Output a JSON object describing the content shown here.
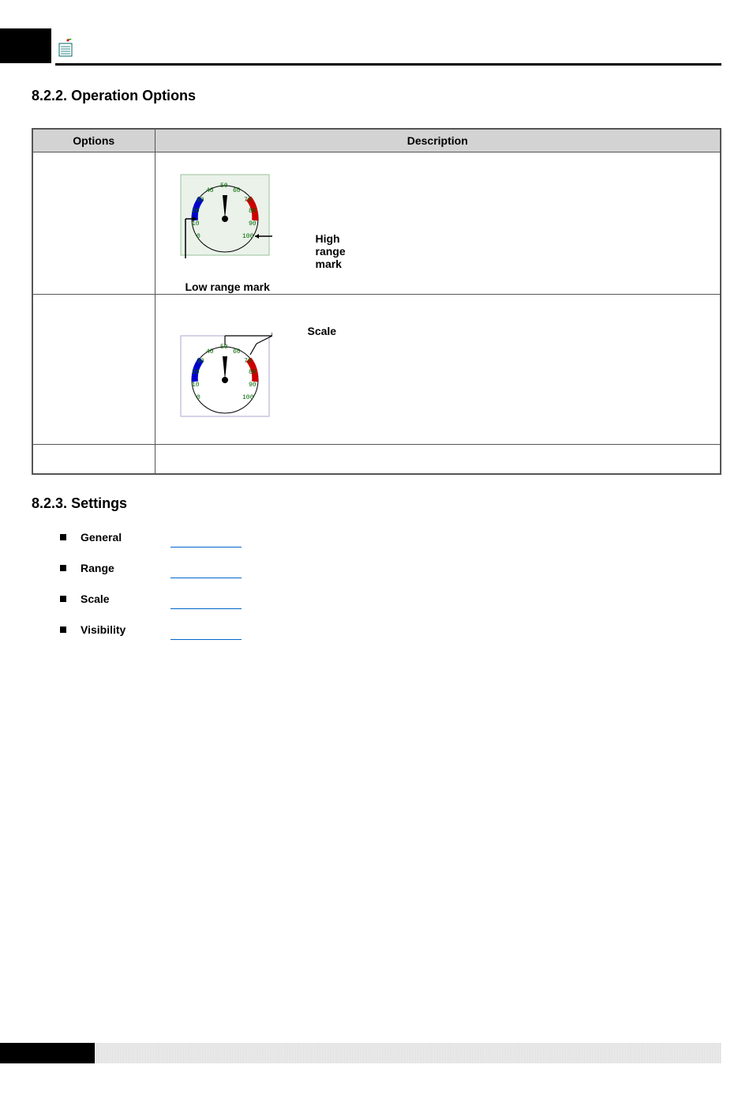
{
  "header": {
    "icon_name": "document-tool-icon"
  },
  "section1": {
    "number": "8.2.2.",
    "title": "Operation Options"
  },
  "table": {
    "col1_header": "Options",
    "col2_header": "Description",
    "row1": {
      "high_label": "High range mark",
      "low_label": "Low range mark"
    },
    "row2": {
      "scale_label": "Scale"
    }
  },
  "gauge_ticks": [
    "0",
    "10",
    "20",
    "30",
    "40",
    "50",
    "60",
    "70",
    "80",
    "90",
    "100"
  ],
  "section2": {
    "number": "8.2.3.",
    "title": "Settings"
  },
  "settings": {
    "items": [
      {
        "label": "General"
      },
      {
        "label": "Range"
      },
      {
        "label": "Scale"
      },
      {
        "label": "Visibility"
      }
    ]
  }
}
